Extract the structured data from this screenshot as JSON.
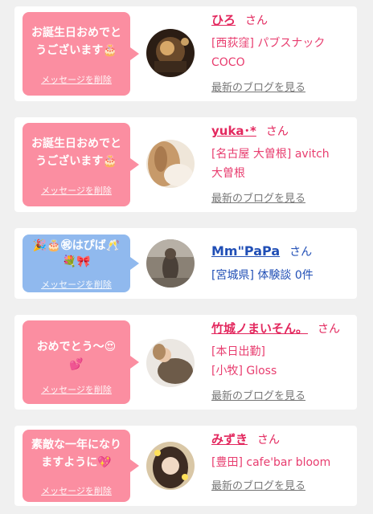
{
  "colors": {
    "pink": "#fb8ea1",
    "blue": "#90b9ee",
    "name_pink": "#e3285e",
    "name_blue": "#214fb6",
    "text_pink": "#e83d6f",
    "link_gray": "#777777"
  },
  "cards": [
    {
      "message_line1": "お誕生日おめでと",
      "message_line2": "うございます🎂",
      "delete_label": "メッセージを削除",
      "name": "ひろ",
      "honorific": "さん",
      "shop_line1": "[西荻窪] パブスナック",
      "shop_line2": "COCO",
      "blog_link": "最新のブログを見る"
    },
    {
      "message_line1": "お誕生日おめでと",
      "message_line2": "うございます🎂",
      "delete_label": "メッセージを削除",
      "name": "yuka･*",
      "honorific": "さん",
      "shop_line1": "[名古屋 大曽根] avitch",
      "shop_line2": "大曽根",
      "blog_link": "最新のブログを見る"
    },
    {
      "message_line1": "🎉🎂㊗はぴば🥂",
      "message_line2": "💐🎀",
      "delete_label": "メッセージを削除",
      "name": "Mm\"PaPa",
      "honorific": "さん",
      "shop_line1": "[宮城県] 体験談 0件"
    },
    {
      "message_line1": "おめでとう〜😍",
      "message_line2": "💕",
      "delete_label": "メッセージを削除",
      "name": "竹城ノまいそん。",
      "honorific": "さん",
      "shop_line1": "[本日出勤]",
      "shop_line2": "[小牧] Gloss",
      "blog_link": "最新のブログを見る"
    },
    {
      "message_line1": "素敵な一年になり",
      "message_line2": "ますように💖",
      "delete_label": "メッセージを削除",
      "name": "みずき",
      "honorific": "さん",
      "shop_line1": "[豊田] cafe'bar bloom",
      "blog_link": "最新のブログを見る"
    }
  ]
}
